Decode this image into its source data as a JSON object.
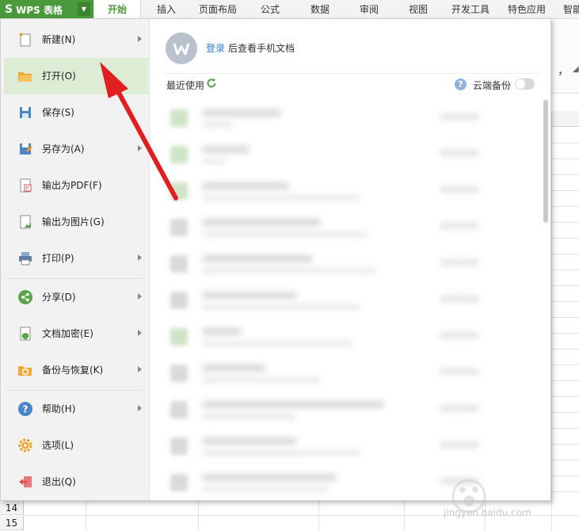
{
  "topbar": {
    "app_name": "WPS 表格",
    "app_logo": "S",
    "tabs": [
      {
        "label": "开始",
        "active": true
      },
      {
        "label": "插入"
      },
      {
        "label": "页面布局"
      },
      {
        "label": "公式"
      },
      {
        "label": "数据"
      },
      {
        "label": "审阅"
      },
      {
        "label": "视图"
      },
      {
        "label": "开发工具"
      },
      {
        "label": "特色应用"
      },
      {
        "label": "智能"
      }
    ],
    "brand_color": "#4a9a3b"
  },
  "ribbon": {
    "fragment": "，"
  },
  "sheet": {
    "row_numbers": [
      "14",
      "15"
    ]
  },
  "file_menu": {
    "items": [
      {
        "label": "新建(N)",
        "icon": "new-document-icon",
        "has_submenu": true
      },
      {
        "label": "打开(O)",
        "icon": "open-folder-icon",
        "highlighted": true
      },
      {
        "label": "保存(S)",
        "icon": "save-icon"
      },
      {
        "label": "另存为(A)",
        "icon": "save-as-icon",
        "has_submenu": true
      },
      {
        "label": "输出为PDF(F)",
        "icon": "pdf-icon"
      },
      {
        "label": "输出为图片(G)",
        "icon": "image-icon"
      },
      {
        "label": "打印(P)",
        "icon": "print-icon",
        "has_submenu": true
      },
      {
        "label": "分享(D)",
        "icon": "share-icon",
        "has_submenu": true
      },
      {
        "label": "文档加密(E)",
        "icon": "encrypt-icon",
        "has_submenu": true
      },
      {
        "label": "备份与恢复(K)",
        "icon": "backup-icon",
        "has_submenu": true
      },
      {
        "label": "帮助(H)",
        "icon": "help-icon",
        "has_submenu": true
      },
      {
        "label": "选项(L)",
        "icon": "gear-icon"
      },
      {
        "label": "退出(Q)",
        "icon": "exit-icon"
      }
    ]
  },
  "account": {
    "login_link": "登录",
    "login_text": "后查看手机文档",
    "avatar_icon": "wps-avatar-icon"
  },
  "recent": {
    "title": "最近使用",
    "refresh_icon": "refresh-icon",
    "cloud_backup_label": "云端备份",
    "cloud_backup_on": false
  },
  "watermark": {
    "text": "jingyan.baidu.com"
  }
}
